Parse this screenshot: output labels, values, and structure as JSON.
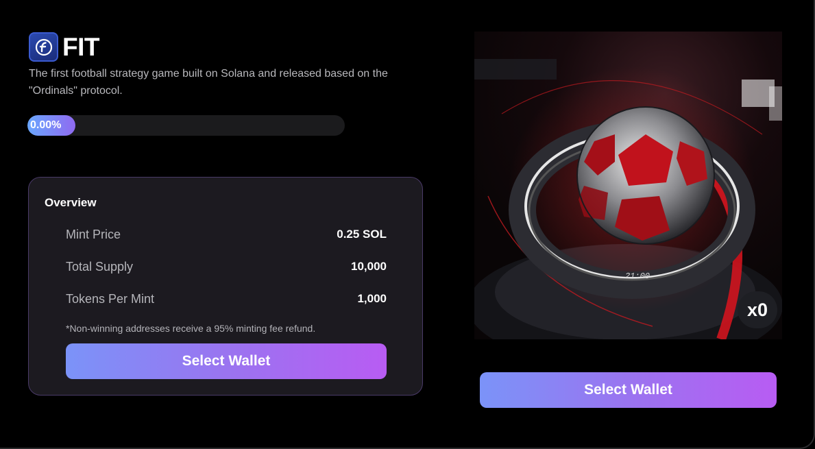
{
  "brand": {
    "name": "FIT",
    "logo_icon": "fit-logo-icon",
    "tagline": "The first football strategy game built on Solana and released based on the \"Ordinals\" protocol."
  },
  "progress": {
    "value_percent": 0.0,
    "label": "0.00%"
  },
  "overview": {
    "title": "Overview",
    "rows": [
      {
        "label": "Mint Price",
        "value": "0.25 SOL"
      },
      {
        "label": "Total Supply",
        "value": "10,000"
      },
      {
        "label": "Tokens Per Mint",
        "value": "1,000"
      }
    ],
    "note": "*Non-winning addresses receive a 95% minting fee refund.",
    "button_label": "Select Wallet"
  },
  "artwork": {
    "description_icon": "football-artwork-image",
    "count_badge": "x0",
    "clock_text": "21:00"
  },
  "main_button_label": "Select Wallet",
  "colors": {
    "accent_start": "#7b93f8",
    "accent_end": "#b85cf3",
    "card_border": "#4a3a68",
    "card_bg": "#1c1a20"
  }
}
